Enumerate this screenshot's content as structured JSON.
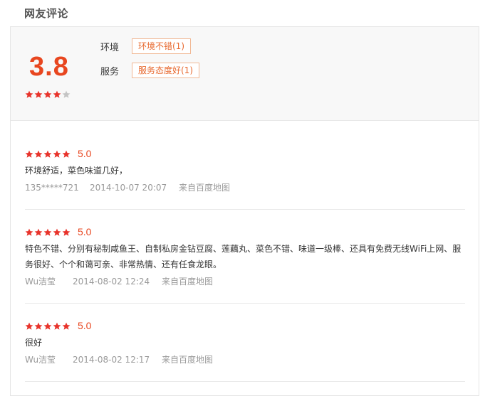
{
  "section_title": "网友评论",
  "summary": {
    "score": "3.8",
    "stars": 4,
    "max_stars": 5,
    "tags": [
      {
        "label": "环境",
        "tag": "环境不错(1)"
      },
      {
        "label": "服务",
        "tag": "服务态度好(1)"
      }
    ]
  },
  "reviews": [
    {
      "stars": 5,
      "rating": "5.0",
      "content": "环境舒适，菜色味道几好，",
      "user": "135*****721",
      "time": "2014-10-07 20:07",
      "source": "来自百度地图"
    },
    {
      "stars": 5,
      "rating": "5.0",
      "content": "特色不错、分别有秘制咸鱼王、自制私房金钻豆腐、莲藕丸、菜色不错、味道一级棒、还具有免费无线WiFi上网、服务很好、个个和蔼可亲、非常热情、还有任食龙眼。",
      "user": "Wu洁莹",
      "time": "2014-08-02 12:24",
      "source": "来自百度地图"
    },
    {
      "stars": 5,
      "rating": "5.0",
      "content": "很好",
      "user": "Wu洁莹",
      "time": "2014-08-02 12:17",
      "source": "来自百度地图"
    }
  ],
  "colors": {
    "accent": "#e8461f",
    "star_on": "#e8332b",
    "star_off": "#c4c4c4",
    "tag_border": "#f1b895",
    "tag_text": "#e8692f",
    "meta": "#999999"
  }
}
